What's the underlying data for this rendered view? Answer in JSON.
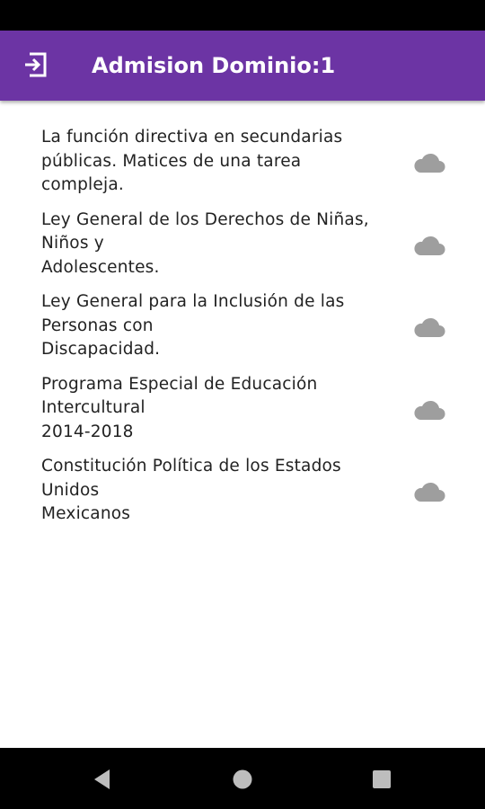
{
  "app_bar": {
    "title": "Admision Dominio:1",
    "icon": "login-icon",
    "color": "#6c34a4"
  },
  "documents": [
    {
      "title": "La función directiva en secundarias\npúblicas. Matices de una tarea\ncompleja.",
      "icon": "cloud-icon"
    },
    {
      "title": "Ley General de los Derechos de Niñas,\nNiños y\nAdolescentes.",
      "icon": "cloud-icon"
    },
    {
      "title": "Ley General para la Inclusión de las\nPersonas con\nDiscapacidad.",
      "icon": "cloud-icon"
    },
    {
      "title": "Programa Especial de Educación\nIntercultural\n2014-2018",
      "icon": "cloud-icon"
    },
    {
      "title": "Constitución Política de los Estados\nUnidos\nMexicanos",
      "icon": "cloud-icon"
    }
  ],
  "nav_bar": {
    "buttons": [
      "back-icon",
      "home-icon",
      "recents-icon"
    ]
  }
}
